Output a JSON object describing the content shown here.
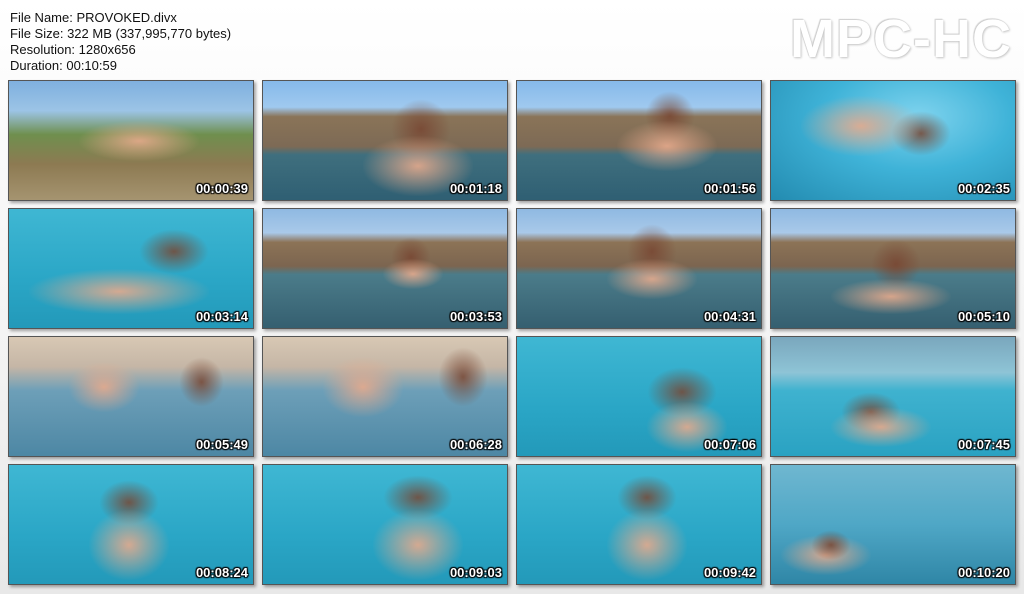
{
  "file_info": {
    "file_name": "File Name: PROVOKED.divx",
    "file_size": "File Size: 322 MB (337,995,770 bytes)",
    "resolution": "Resolution: 1280x656",
    "duration": "Duration: 00:10:59"
  },
  "logo": "MPC-HC",
  "thumbnails": [
    {
      "time": "00:00:39",
      "scene": "patio"
    },
    {
      "time": "00:01:18",
      "scene": "pool-edge"
    },
    {
      "time": "00:01:56",
      "scene": "pool-edge"
    },
    {
      "time": "00:02:35",
      "scene": "uw-bright"
    },
    {
      "time": "00:03:14",
      "scene": "uw-teal"
    },
    {
      "time": "00:03:53",
      "scene": "fence"
    },
    {
      "time": "00:04:31",
      "scene": "fence"
    },
    {
      "time": "00:05:10",
      "scene": "fence"
    },
    {
      "time": "00:05:49",
      "scene": "pool-hazy"
    },
    {
      "time": "00:06:28",
      "scene": "pool-hazy"
    },
    {
      "time": "00:07:06",
      "scene": "uw-teal"
    },
    {
      "time": "00:07:45",
      "scene": "uw-surface"
    },
    {
      "time": "00:08:24",
      "scene": "uw-teal"
    },
    {
      "time": "00:09:03",
      "scene": "uw-teal"
    },
    {
      "time": "00:09:42",
      "scene": "uw-teal"
    },
    {
      "time": "00:10:20",
      "scene": "uw-bottom"
    }
  ]
}
